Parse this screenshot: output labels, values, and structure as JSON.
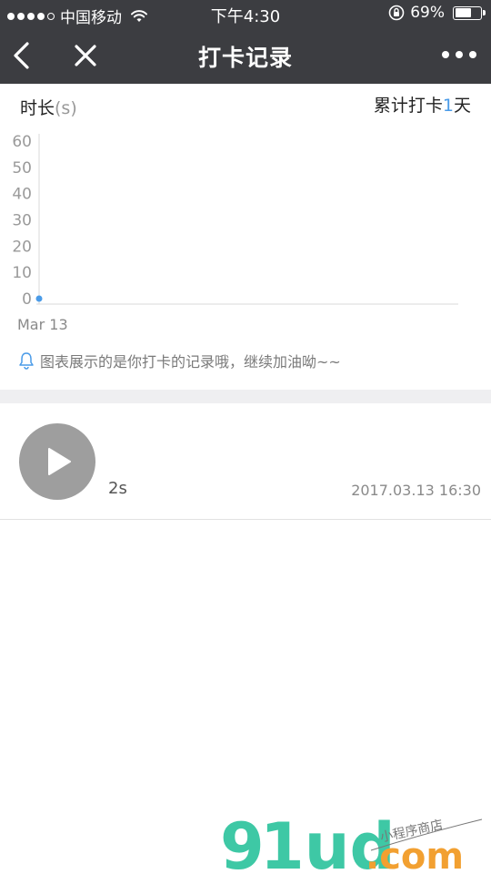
{
  "status_bar": {
    "carrier": "中国移动",
    "time": "下午4:30",
    "battery_percent": "69%",
    "battery_level": 0.69,
    "signal_bars_filled": 4,
    "signal_bars_total": 5
  },
  "nav": {
    "title": "打卡记录",
    "back_icon": "chevron-left-icon",
    "close_icon": "close-icon",
    "more_icon": "more-dots-icon"
  },
  "chart_header": {
    "ylabel": "时长",
    "unit": "(s)",
    "streak_prefix": "累计打卡",
    "streak_days": "1",
    "streak_suffix": "天"
  },
  "chart_data": {
    "type": "line",
    "x": [
      "Mar 13"
    ],
    "series": [
      {
        "values": [
          0
        ]
      }
    ],
    "y_ticks": [
      "60",
      "50",
      "40",
      "30",
      "20",
      "10",
      "0"
    ],
    "ylim": [
      0,
      60
    ],
    "xlabel": "",
    "ylabel": "时长(s)",
    "grid": false,
    "point_color": "#4a9be8"
  },
  "tip": {
    "icon": "bell-icon",
    "text": "图表展示的是你打卡的记录哦，继续加油呦~~"
  },
  "records": [
    {
      "duration": "2s",
      "timestamp": "2017.03.13 16:30",
      "icon": "play-icon"
    }
  ],
  "watermark": {
    "brand_number": "9",
    "brand_rest": "1ud",
    "tld": ".com",
    "tagline": "小程序商店"
  },
  "colors": {
    "nav_bg": "#3c3d41",
    "accent": "#4a9be8",
    "play_button": "#9e9e9e",
    "divider": "#efeff1"
  }
}
